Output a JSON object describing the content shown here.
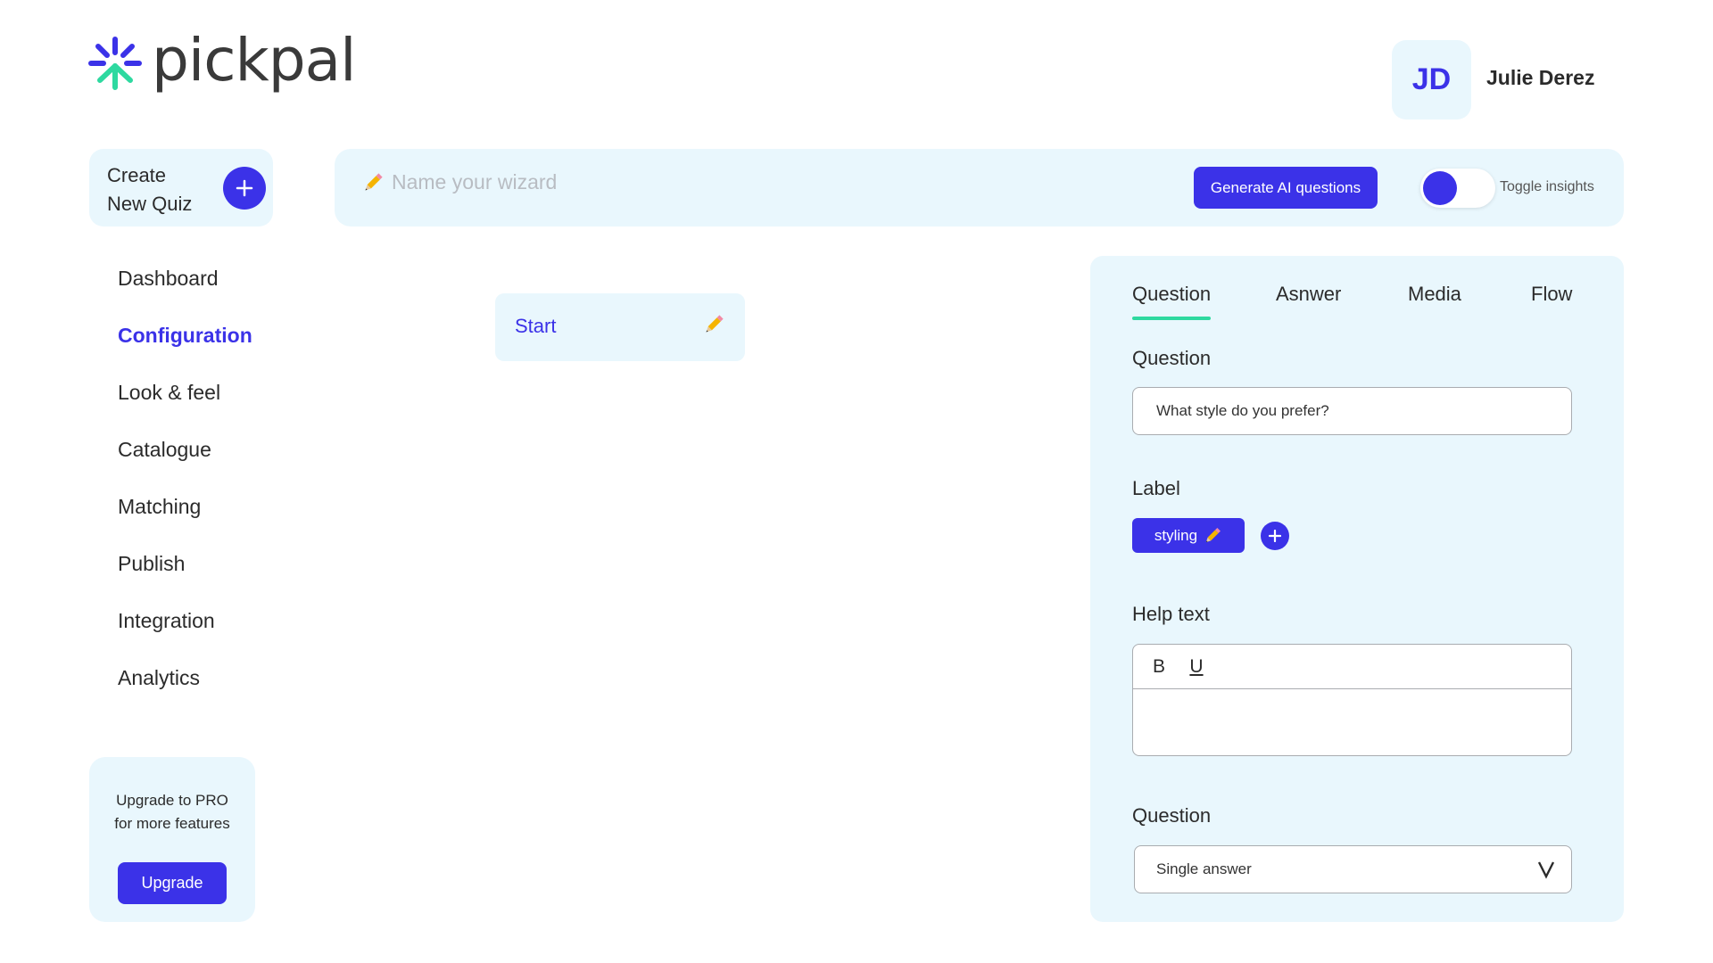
{
  "app": {
    "name": "pickpal"
  },
  "user": {
    "initials": "JD",
    "name": "Julie Derez"
  },
  "create_quiz": {
    "label_line1": "Create",
    "label_line2": "New Quiz"
  },
  "sidebar": {
    "items": [
      {
        "label": "Dashboard"
      },
      {
        "label": "Configuration"
      },
      {
        "label": "Look & feel"
      },
      {
        "label": "Catalogue"
      },
      {
        "label": "Matching"
      },
      {
        "label": "Publish"
      },
      {
        "label": "Integration"
      },
      {
        "label": "Analytics"
      }
    ],
    "active": "Configuration"
  },
  "upgrade": {
    "text_line1": "Upgrade to PRO",
    "text_line2": "for more features",
    "button": "Upgrade"
  },
  "topbar": {
    "name_placeholder": "Name your wizard",
    "generate_button": "Generate AI questions",
    "toggle_label": "Toggle insights",
    "toggle_on": true
  },
  "canvas": {
    "start_node": "Start"
  },
  "panel": {
    "tabs": [
      {
        "label": "Question"
      },
      {
        "label": "Asnwer"
      },
      {
        "label": "Media"
      },
      {
        "label": "Flow"
      }
    ],
    "active_tab": "Question",
    "question_label": "Question",
    "question_value": "What style do you prefer?",
    "label_label": "Label",
    "chip": "styling",
    "help_label": "Help text",
    "bold": "B",
    "underline": "U",
    "type_label": "Question",
    "type_value": "Single answer",
    "chevron": "V"
  },
  "colors": {
    "primary": "#3b32e8",
    "panel_bg": "#e9f7fd",
    "accent": "#2ed9a0"
  }
}
